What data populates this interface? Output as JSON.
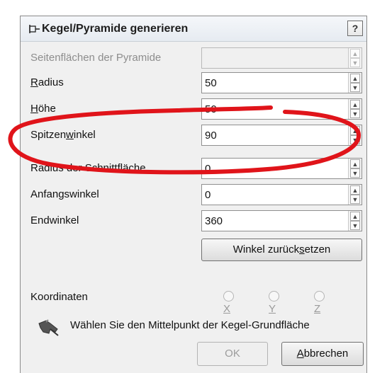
{
  "window": {
    "title": "Kegel/Pyramide generieren",
    "help_label": "?"
  },
  "fields": [
    {
      "label": "Seitenflächen der Pyramide",
      "value": "",
      "enabled": false
    },
    {
      "label": "Radius",
      "value": "50",
      "enabled": true
    },
    {
      "label": "Höhe",
      "value": "50",
      "enabled": true
    },
    {
      "label": "Spitzenwinkel",
      "value": "90",
      "enabled": true,
      "highlighted": true
    },
    {
      "label": "Radius der Schnittfläche",
      "value": "0",
      "enabled": true
    },
    {
      "label": "Anfangswinkel",
      "value": "0",
      "enabled": true
    },
    {
      "label": "Endwinkel",
      "value": "360",
      "enabled": true
    }
  ],
  "reset_button": {
    "label": "Winkel zurücksetzen"
  },
  "coordinates": {
    "label": "Koordinaten",
    "options": [
      "X",
      "Y",
      "Z"
    ],
    "enabled": false
  },
  "hint": {
    "text": "Wählen Sie den Mittelpunkt der Kegel-Grundfläche",
    "icon": "pointer-hand-icon"
  },
  "buttons": {
    "ok_label": "OK",
    "cancel_label": "Abbrechen"
  },
  "annotation": {
    "color": "#e0141a",
    "shape": "hand-drawn ellipse"
  },
  "colors": {
    "dialog_bg": "#f0f0f0",
    "title_bg": "#e6ebf1",
    "disabled_text": "#8d8d8d"
  }
}
